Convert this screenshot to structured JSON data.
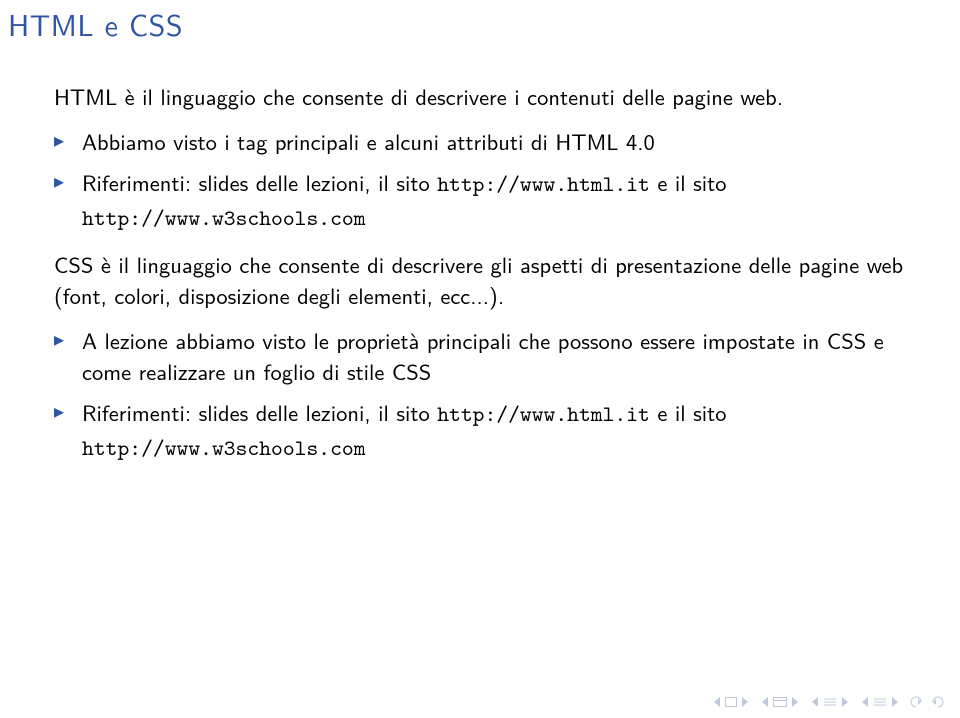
{
  "title": "HTML e CSS",
  "para1": "HTML è il linguaggio che consente di descrivere i contenuti delle pagine web.",
  "bullets1": [
    {
      "text": "Abbiamo visto i tag principali e alcuni attributi di HTML 4.0"
    },
    {
      "pre": "Riferimenti: slides delle lezioni, il sito ",
      "code1": "http://www.html.it",
      "mid": " e il sito ",
      "code2": "http://www.w3schools.com"
    }
  ],
  "para2": "CSS è il linguaggio che consente di descrivere gli aspetti di presentazione delle pagine web (font, colori, disposizione degli elementi, ecc...).",
  "bullets2": [
    {
      "text": "A lezione abbiamo visto le proprietà principali che possono essere impostate in CSS e come realizzare un foglio di stile CSS"
    },
    {
      "pre": "Riferimenti: slides delle lezioni, il sito ",
      "code1": "http://www.html.it",
      "mid": " e il sito ",
      "code2": "http://www.w3schools.com"
    }
  ]
}
